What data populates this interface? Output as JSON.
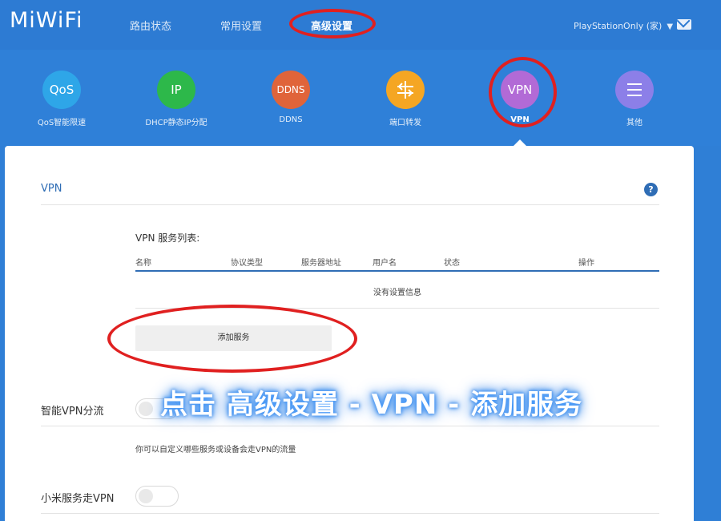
{
  "header": {
    "logo": "MiWiFi",
    "tabs": [
      {
        "label": "路由状态"
      },
      {
        "label": "常用设置"
      },
      {
        "label": "高级设置",
        "active": true
      }
    ],
    "user": "PlayStationOnly (家)",
    "icons": {
      "user_menu": "chevron-down-icon",
      "mail": "mail-icon"
    }
  },
  "features": [
    {
      "icon_text": "QoS",
      "label": "QoS智能限速",
      "color": "#2ea6e8"
    },
    {
      "icon_text": "IP",
      "label": "DHCP静态IP分配",
      "color": "#2db84a"
    },
    {
      "icon_text": "DDNS",
      "label": "DDNS",
      "color": "#e0643a"
    },
    {
      "icon_text": "",
      "icon": "port-forward-icon",
      "label": "端口转发",
      "color": "#f5a623"
    },
    {
      "icon_text": "VPN",
      "label": "VPN",
      "color": "#b26ad6",
      "active": true
    },
    {
      "icon_text": "",
      "icon": "menu-icon",
      "label": "其他",
      "color": "#8c7fe8"
    }
  ],
  "vpn": {
    "title": "VPN",
    "help": "?",
    "list_title": "VPN 服务列表:",
    "columns": [
      "名称",
      "协议类型",
      "服务器地址",
      "用户名",
      "状态",
      "操作"
    ],
    "empty_text": "没有设置信息",
    "add_button": "添加服务"
  },
  "smart_vpn": {
    "label": "智能VPN分流",
    "enabled": false
  },
  "hint": "你可以自定义哪些服务或设备会走VPN的流量",
  "xiaomi_vpn": {
    "label": "小米服务走VPN",
    "enabled": false
  },
  "overlay_caption": "点击 高级设置 - VPN - 添加服务",
  "colors": {
    "accent": "#2f6db5",
    "header_bg": "#2d7bd3",
    "annotation_red": "#e02020"
  }
}
